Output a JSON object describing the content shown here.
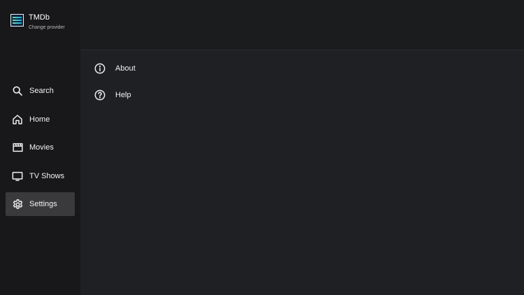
{
  "provider": {
    "name": "TMDb",
    "subtitle": "Change provider"
  },
  "sidebar": {
    "items": [
      {
        "label": "Search",
        "icon": "search-icon"
      },
      {
        "label": "Home",
        "icon": "home-icon"
      },
      {
        "label": "Movies",
        "icon": "clapperboard-icon"
      },
      {
        "label": "TV Shows",
        "icon": "tv-icon"
      },
      {
        "label": "Settings",
        "icon": "gear-icon",
        "active": true
      }
    ]
  },
  "settings_menu": {
    "items": [
      {
        "label": "About",
        "icon": "info-icon"
      },
      {
        "label": "Help",
        "icon": "help-circle-icon"
      }
    ]
  },
  "colors": {
    "background": "#1f2023",
    "sidebar": "#18181a",
    "active_item": "#3a3a3d",
    "text": "#f2f2f2"
  }
}
